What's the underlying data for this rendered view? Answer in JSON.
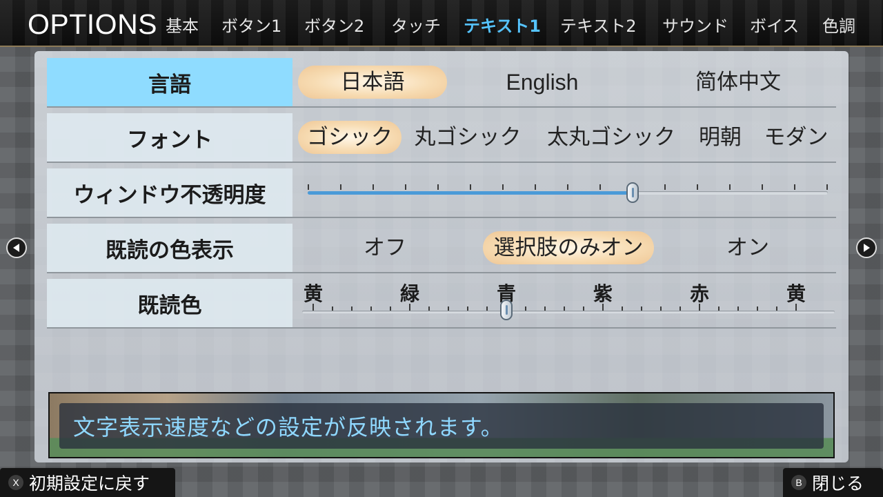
{
  "header": {
    "title": "OPTIONS",
    "tabs": [
      {
        "label": "基本",
        "active": false
      },
      {
        "label": "ボタン1",
        "active": false
      },
      {
        "label": "ボタン2",
        "active": false
      },
      {
        "label": "タッチ",
        "active": false
      },
      {
        "label": "テキスト1",
        "active": true
      },
      {
        "label": "テキスト2",
        "active": false
      },
      {
        "label": "サウンド",
        "active": false
      },
      {
        "label": "ボイス",
        "active": false
      },
      {
        "label": "色調",
        "active": false
      }
    ]
  },
  "settings": {
    "language": {
      "label": "言語",
      "options": [
        "日本語",
        "English",
        "简体中文"
      ],
      "selected": "日本語"
    },
    "font": {
      "label": "フォント",
      "options": [
        "ゴシック",
        "丸ゴシック",
        "太丸ゴシック",
        "明朝",
        "モダン"
      ],
      "selected": "ゴシック"
    },
    "window_opacity": {
      "label": "ウィンドウ不透明度",
      "level": 0.625,
      "tick_count": 17
    },
    "read_color_display": {
      "label": "既読の色表示",
      "options": [
        "オフ",
        "選択肢のみオン",
        "オン"
      ],
      "selected": "選択肢のみオン"
    },
    "read_color": {
      "label": "既読色",
      "colors": [
        "黄",
        "緑",
        "青",
        "紫",
        "赤",
        "黄"
      ],
      "selected_index": 2
    }
  },
  "description": "文字表示速度などの設定が反映されます。",
  "footer": {
    "reset": {
      "button": "X",
      "label": "初期設定に戻す"
    },
    "close": {
      "button": "B",
      "label": "閉じる"
    }
  },
  "colors": {
    "accent": "#56c4ff",
    "active_row": "#8fdcff",
    "selection": "#f7dcb3",
    "slider_fill": "#4a9ad8"
  },
  "icons": {
    "prev": "triangle-left-icon",
    "next": "triangle-right-icon"
  }
}
